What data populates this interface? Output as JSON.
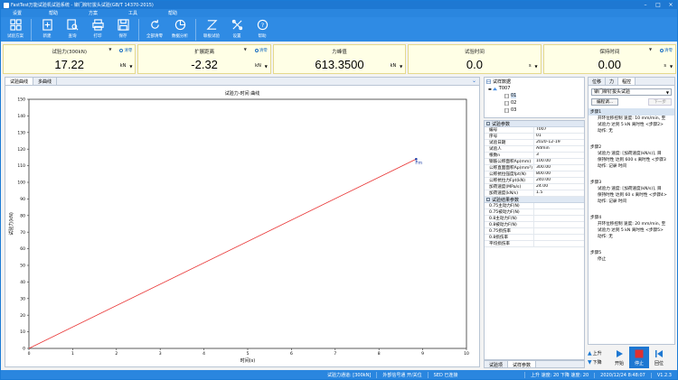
{
  "window": {
    "title": "FastTest万能试验机试验系统 - 铆门柳钉拔头试验(GB/T 14370-2015)"
  },
  "menu": [
    "设置",
    "帮助",
    "方案",
    "工具",
    "帮助"
  ],
  "toolbar": {
    "items": [
      {
        "label": "试验方案",
        "icon": "method-icon"
      },
      {
        "label": "新建",
        "icon": "new-icon"
      },
      {
        "label": "查询",
        "icon": "query-icon"
      },
      {
        "label": "打印",
        "icon": "print-icon"
      },
      {
        "label": "保存",
        "icon": "save-icon"
      },
      {
        "label": "全部清零",
        "icon": "reset-icon"
      },
      {
        "label": "数据分析",
        "icon": "analysis-icon"
      },
      {
        "label": "联板试验",
        "icon": "joint-icon"
      },
      {
        "label": "设置",
        "icon": "settings-icon"
      },
      {
        "label": "帮助",
        "icon": "help-icon"
      }
    ]
  },
  "readouts": [
    {
      "label": "试验力(300kN)",
      "option": "清零",
      "value": "17.22",
      "unit": "kN"
    },
    {
      "label": "扩展距离",
      "option": "清零",
      "value": "-2.32",
      "unit": "kN"
    },
    {
      "label": "力峰值",
      "option": "",
      "value": "613.3500",
      "unit": "kN"
    },
    {
      "label": "试验时间",
      "option": "",
      "value": "0.0",
      "unit": "s"
    },
    {
      "label": "保持时间",
      "option": "清零",
      "value": "0.00",
      "unit": "s"
    }
  ],
  "chart_tabs": [
    "试验曲线",
    "多曲线"
  ],
  "chart_data": {
    "type": "line",
    "title": "试验力-时间 曲线",
    "xlabel": "时间(s)",
    "ylabel": "试验力(kN)",
    "xlim": [
      0,
      10
    ],
    "ylim": [
      0,
      150
    ],
    "xticks": [
      0,
      1,
      2,
      3,
      4,
      5,
      6,
      7,
      8,
      9,
      10
    ],
    "yticks": [
      0,
      10,
      20,
      30,
      40,
      50,
      60,
      70,
      80,
      90,
      100,
      110,
      120,
      130,
      140,
      150
    ],
    "grid": false,
    "series": [
      {
        "values": [
          [
            0,
            0
          ],
          [
            8.85,
            114
          ]
        ],
        "color": "#e83030"
      }
    ],
    "annotations": [
      {
        "text": "Fm",
        "x": 8.85,
        "y": 114
      }
    ]
  },
  "tree": {
    "root": "试样数据",
    "group": "T007",
    "items": [
      "01",
      "02",
      "03"
    ]
  },
  "params": {
    "group1": "试验参数",
    "rows1": [
      {
        "k": "编号",
        "v": "T007"
      },
      {
        "k": "序号",
        "v": "01"
      },
      {
        "k": "试验日期",
        "v": "2020-12-19"
      },
      {
        "k": "试验人",
        "v": "Admin"
      },
      {
        "k": "根数n",
        "v": "3"
      },
      {
        "k": "钢筋公称面积Ap(mm)",
        "v": "100.00"
      },
      {
        "k": "公称直面面积Ap(mm²)",
        "v": "300.00"
      },
      {
        "k": "公称抗拉强度fpt(N)",
        "v": "800.00"
      },
      {
        "k": "公称抗拉力Fpt(kN)",
        "v": "240.00"
      },
      {
        "k": "加荷速度(MPa/s)",
        "v": "24.00"
      },
      {
        "k": "加荷速度(kN/s)",
        "v": "1.5"
      }
    ],
    "group2": "试验结果参数",
    "rows2": [
      {
        "k": "0.75主动力F(N)",
        "v": ""
      },
      {
        "k": "0.75被动力F(N)",
        "v": ""
      },
      {
        "k": "0.8主动力F(N)",
        "v": ""
      },
      {
        "k": "0.8被动力F(N)",
        "v": ""
      },
      {
        "k": "0.75损伤率",
        "v": ""
      },
      {
        "k": "0.8损伤率",
        "v": ""
      },
      {
        "k": "平均损伤率",
        "v": ""
      }
    ]
  },
  "bottom_tabs": [
    "试验项",
    "试样参数"
  ],
  "method": {
    "tabs": [
      "位移",
      "力",
      "程控"
    ],
    "select": "铆门柳钉拔头试验",
    "edit_btn": "编程调...",
    "next_btn": "下一步",
    "steps": [
      {
        "name": "步骤1",
        "lines": [
          "开环位移控制 速度: 10 mm/min, 至",
          "试验力 达到 5 kN 离时性 <步骤2>",
          "动作: 无"
        ]
      },
      {
        "name": "步骤2",
        "lines": [
          "试验力 速度: [加荷速度(kN/s)], 目",
          "保持时性 达到 600 s 离时性 <步骤3",
          "动作: 记录 时间"
        ]
      },
      {
        "name": "步骤3",
        "lines": [
          "试验力 速度: [加荷速度(kN/s)], 目",
          "保持时性 达到 60 s 离时性 <步骤4>",
          "动作: 记录 时间"
        ]
      },
      {
        "name": "步骤4",
        "lines": [
          "开环位移控制 速度: 20 mm/min, 至",
          "试验力 达到 5 kN 离时性 <步骤5>",
          "动作: 无"
        ]
      },
      {
        "name": "步骤5",
        "lines": [
          "停止"
        ]
      }
    ]
  },
  "actions": {
    "up": "上升",
    "down": "下降",
    "start": "开始",
    "stop": "停止",
    "return": "回位"
  },
  "status": {
    "sensor": "试验力通道: [300kN]",
    "signal": "外部信号通 开/关位",
    "sed": "SED 已连接",
    "speed": "上升 速度: 20 下降 速度: 20",
    "datetime": "2020/12/24 8:48:07",
    "version": "V1.2.3"
  },
  "colors": {
    "accent": "#1e78d2",
    "readout_bg": "#ffffe6",
    "curve": "#e83030",
    "stop": "#e03030"
  }
}
